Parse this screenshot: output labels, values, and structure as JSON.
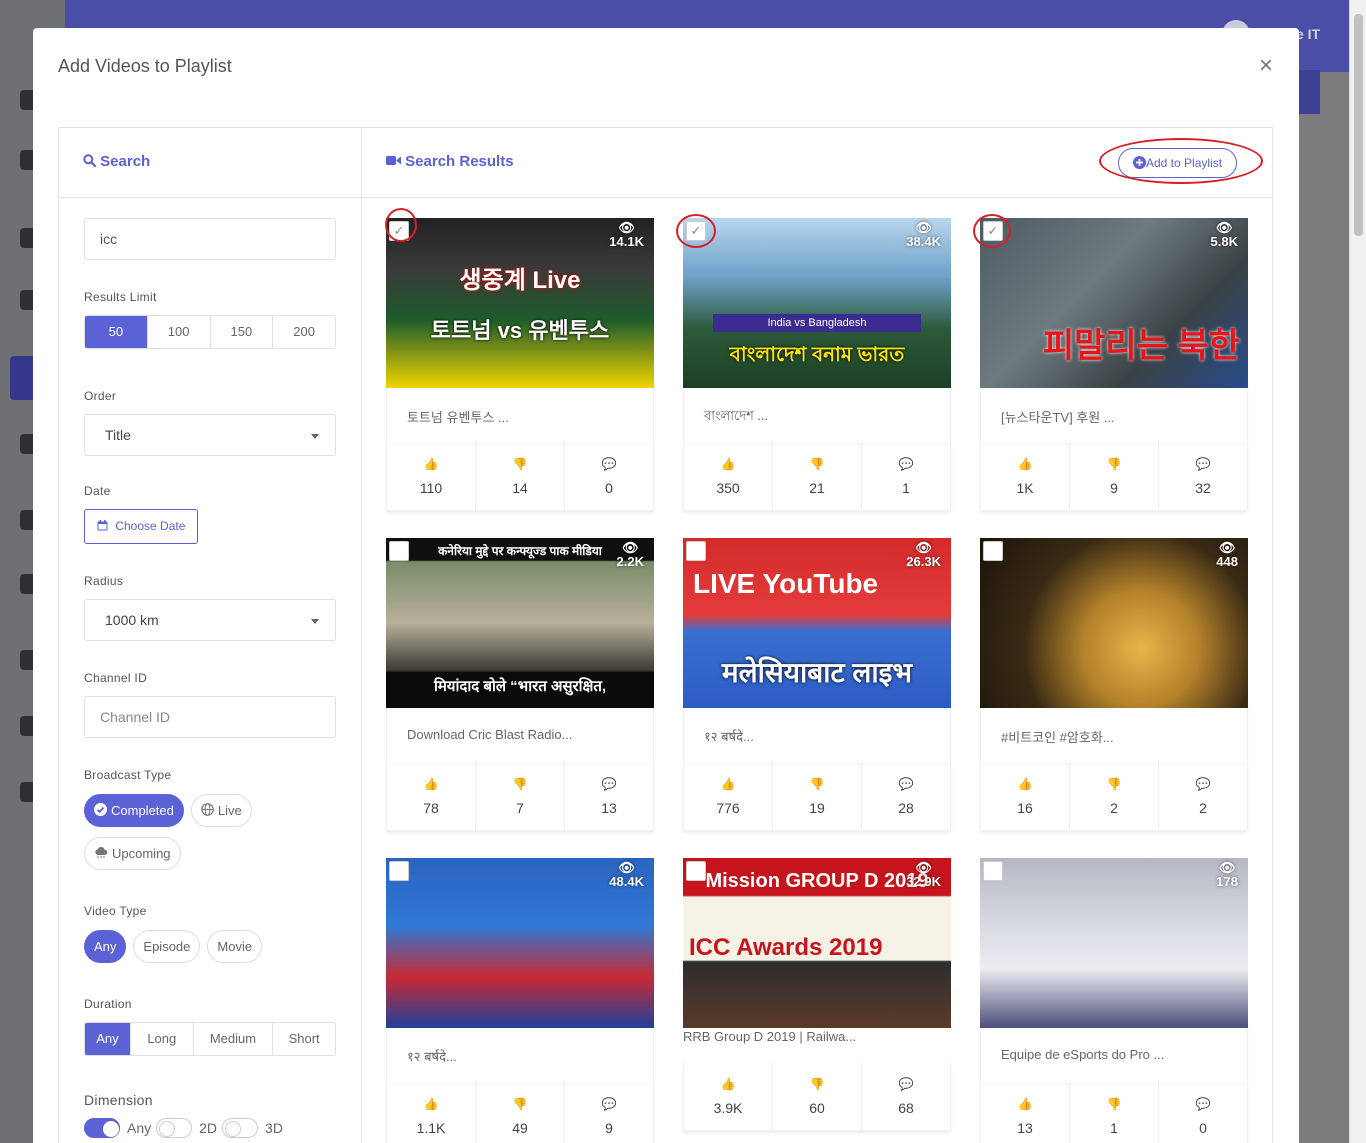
{
  "background": {
    "user_label": "e IT"
  },
  "modal": {
    "title": "Add Videos to Playlist",
    "close": "×",
    "search_panel": {
      "heading": "Search",
      "query_value": "icc",
      "results_limit_label": "Results Limit",
      "results_limit_options": [
        "50",
        "100",
        "150",
        "200"
      ],
      "order_label": "Order",
      "order_value": "Title",
      "date_label": "Date",
      "date_button": "Choose Date",
      "radius_label": "Radius",
      "radius_value": "1000 km",
      "channel_label": "Channel ID",
      "channel_placeholder": "Channel ID",
      "broadcast_label": "Broadcast Type",
      "broadcast_options": [
        "Completed",
        "Live",
        "Upcoming"
      ],
      "video_type_label": "Video Type",
      "video_type_options": [
        "Any",
        "Episode",
        "Movie"
      ],
      "duration_label": "Duration",
      "duration_options": [
        "Any",
        "Long",
        "Medium",
        "Short"
      ],
      "dimension_label": "Dimension",
      "dimension_options": [
        "Any",
        "2D",
        "3D"
      ]
    },
    "results_panel": {
      "heading": "Search Results",
      "add_button": "Add to Playlist",
      "videos": [
        {
          "title": "토트넘 유벤투스 ...",
          "views": "14.1K",
          "likes": "110",
          "dislikes": "14",
          "comments": "0",
          "checked": true,
          "overlay_top": "생중계 Live",
          "overlay_bottom": "토트넘 vs 유벤투스"
        },
        {
          "title": "বাংলাদেশ ...",
          "views": "38.4K",
          "likes": "350",
          "dislikes": "21",
          "comments": "1",
          "checked": true,
          "overlay_top": "India vs Bangladesh",
          "overlay_bottom": "বাংলাদেশ বনাম ভারত"
        },
        {
          "title": "[뉴스타운TV] 후원 ...",
          "views": "5.8K",
          "likes": "1K",
          "dislikes": "9",
          "comments": "32",
          "checked": true,
          "overlay_top": "",
          "overlay_bottom": "피말리는 북한"
        },
        {
          "title": "Download Cric Blast Radio...",
          "views": "2.2K",
          "likes": "78",
          "dislikes": "7",
          "comments": "13",
          "checked": false,
          "overlay_top": "कनेरिया मुद्दे पर कन्फ्यूज्ड पाक मीडिया",
          "overlay_bottom": "मियांदाद बोले “भारत असुरक्षित,"
        },
        {
          "title": "१२ बर्षदे...",
          "views": "26.3K",
          "likes": "776",
          "dislikes": "19",
          "comments": "28",
          "checked": false,
          "overlay_top": "LIVE YouTube",
          "overlay_bottom": "मलेसियाबाट लाइभ"
        },
        {
          "title": "#비트코인 #암호화...",
          "views": "448",
          "likes": "16",
          "dislikes": "2",
          "comments": "2",
          "checked": false,
          "overlay_top": "",
          "overlay_bottom": ""
        },
        {
          "title": "१२ बर्षदे...",
          "views": "48.4K",
          "likes": "1.1K",
          "dislikes": "49",
          "comments": "9",
          "checked": false,
          "overlay_top": "",
          "overlay_bottom": ""
        },
        {
          "title": "RRB Group D 2019 | Railwa...",
          "views": "32.9K",
          "likes": "3.9K",
          "dislikes": "60",
          "comments": "68",
          "checked": false,
          "overlay_top": "Mission GROUP D 2019",
          "overlay_bottom": "ICC Awards 2019"
        },
        {
          "title": "Equipe de eSports do Pro ...",
          "views": "178",
          "likes": "13",
          "dislikes": "1",
          "comments": "0",
          "checked": false,
          "overlay_top": "",
          "overlay_bottom": ""
        }
      ]
    }
  }
}
